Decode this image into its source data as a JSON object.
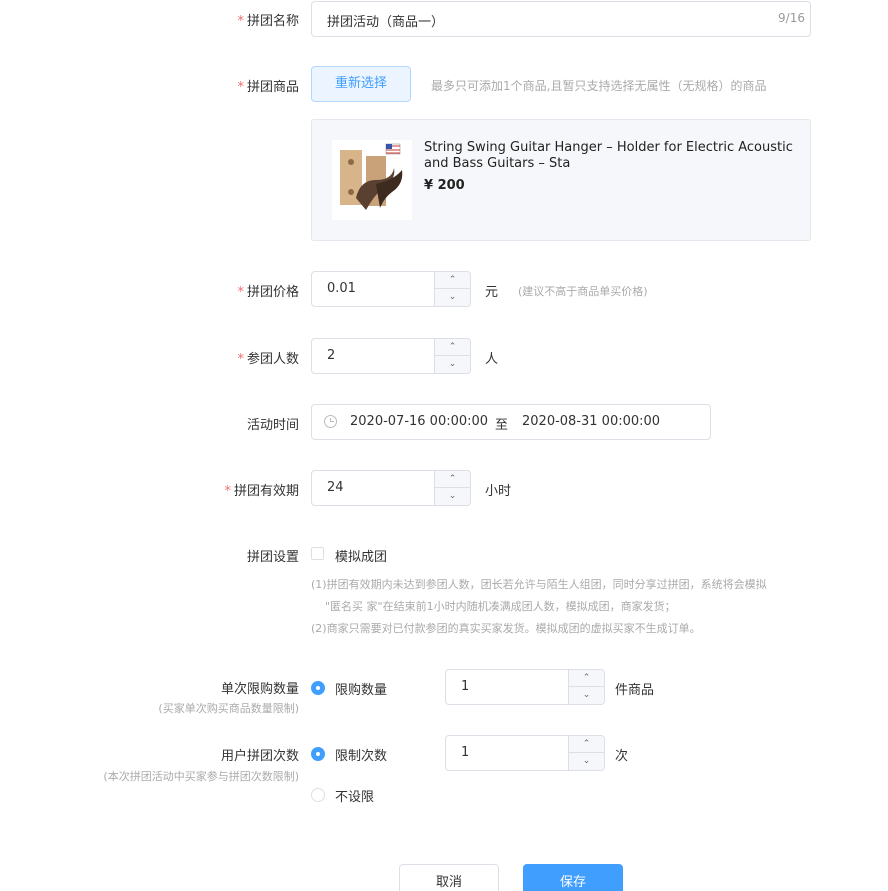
{
  "form": {
    "group_name": {
      "label": "拼团名称",
      "value": "拼团活动（商品一）",
      "counter": "9/16"
    },
    "group_product": {
      "label": "拼团商品",
      "reselect_button": "重新选择",
      "hint": "最多只可添加1个商品,且暂只支持选择无属性（无规格）的商品",
      "product": {
        "title": "String Swing Guitar Hanger – Holder for Electric Acoustic and Bass Guitars – Sta",
        "price": "¥ 200"
      }
    },
    "group_price": {
      "label": "拼团价格",
      "value": "0.01",
      "unit": "元",
      "hint": "(建议不高于商品单买价格)"
    },
    "group_size": {
      "label": "参团人数",
      "value": "2",
      "unit": "人"
    },
    "activity_time": {
      "label": "活动时间",
      "start": "2020-07-16 00:00:00",
      "separator": "至",
      "end": "2020-08-31 00:00:00"
    },
    "group_validity": {
      "label": "拼团有效期",
      "value": "24",
      "unit": "小时"
    },
    "group_settings": {
      "label": "拼团设置",
      "checkbox_label": "模拟成团",
      "desc_line1": "(1)拼团有效期内未达到参团人数，团长若允许与陌生人组团，同时分享过拼团，系统将会模拟",
      "desc_line2": "\"匿名买 家\"在结束前1小时内随机凑满成团人数，模拟成团，商家发货；",
      "desc_line3": "(2)商家只需要对已付款参团的真实买家发货。模拟成团的虚拟买家不生成订单。"
    },
    "per_order_limit": {
      "label": "单次限购数量",
      "sublabel": "(买家单次购买商品数量限制)",
      "option_label": "限购数量",
      "value": "1",
      "unit": "件商品"
    },
    "user_join_limit": {
      "label": "用户拼团次数",
      "sublabel": "(本次拼团活动中买家参与拼团次数限制)",
      "option_limit_label": "限制次数",
      "value": "1",
      "unit": "次",
      "option_unlimited_label": "不设限"
    }
  },
  "actions": {
    "cancel": "取消",
    "save": "保存"
  },
  "icons": {
    "clock": "clock-icon",
    "up": "chevron-up-icon",
    "down": "chevron-down-icon"
  },
  "colors": {
    "primary": "#409eff",
    "required": "#f56c6c"
  }
}
